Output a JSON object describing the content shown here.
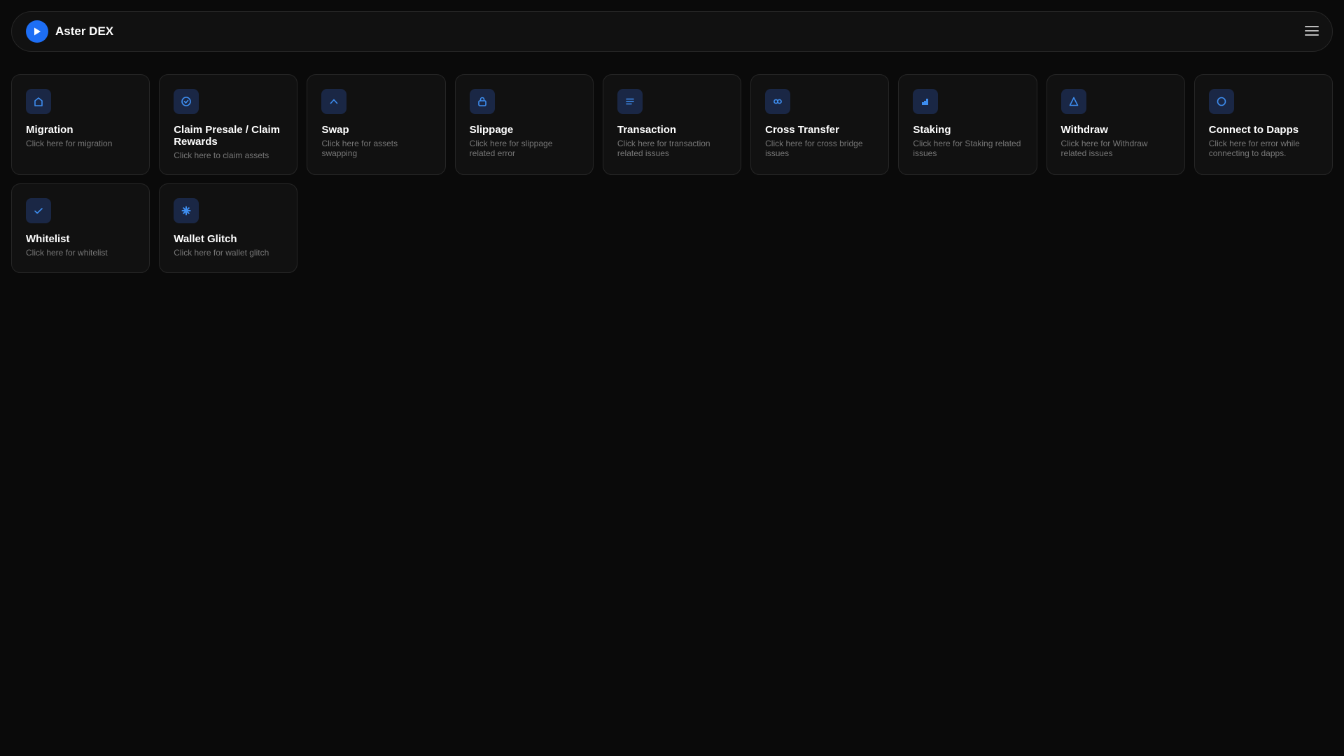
{
  "header": {
    "brand": "Aster DEX"
  },
  "colors": {
    "accent": "#1d6ef5",
    "icon": "#3e8ef0",
    "icon_bg": "#1a2745"
  },
  "cards": [
    {
      "title": "Migration",
      "desc": "Click here for migration",
      "icon": "home-icon"
    },
    {
      "title": "Claim Presale / Claim Rewards",
      "desc": "Click here to claim assets",
      "icon": "check-circle-icon"
    },
    {
      "title": "Swap",
      "desc": "Click here for assets swapping",
      "icon": "chevron-up-icon"
    },
    {
      "title": "Slippage",
      "desc": "Click here for slippage related error",
      "icon": "lock-icon"
    },
    {
      "title": "Transaction",
      "desc": "Click here for transaction related issues",
      "icon": "list-icon"
    },
    {
      "title": "Cross Transfer",
      "desc": "Click here for cross bridge issues",
      "icon": "infinity-icon"
    },
    {
      "title": "Staking",
      "desc": "Click here for Staking related issues",
      "icon": "bar-chart-icon"
    },
    {
      "title": "Withdraw",
      "desc": "Click here for Withdraw related issues",
      "icon": "triangle-icon"
    },
    {
      "title": "Connect to Dapps",
      "desc": "Click here for error while connecting to dapps.",
      "icon": "circle-icon"
    },
    {
      "title": "Whitelist",
      "desc": "Click here for whitelist",
      "icon": "check-icon"
    },
    {
      "title": "Wallet Glitch",
      "desc": "Click here for wallet glitch",
      "icon": "asterisk-icon"
    }
  ]
}
